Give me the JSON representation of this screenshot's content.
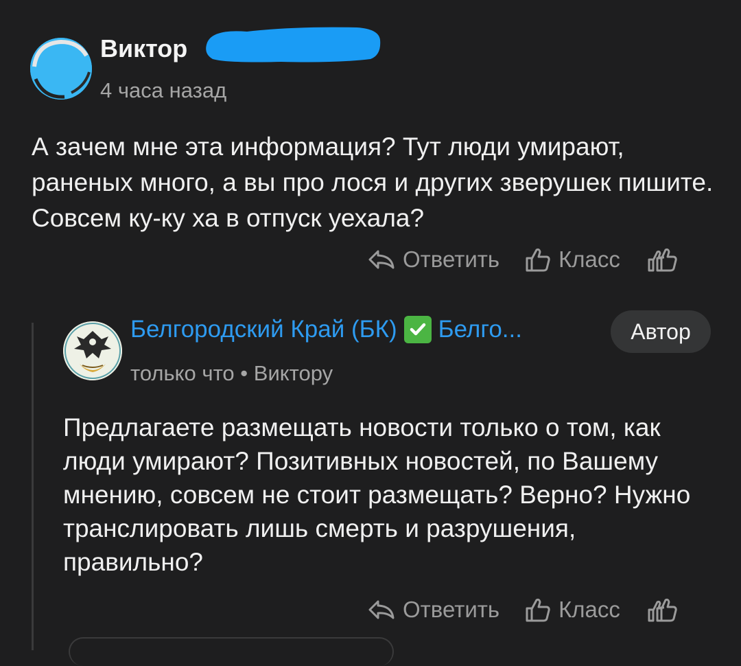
{
  "comment": {
    "author": "Виктор",
    "time": "4 часа назад",
    "text": "А зачем мне эта информация? Тут люди умирают, раненых много, а вы про лося и других зверушек пишите. Совсем ку-ку ха в отпуск уехала?",
    "actions": {
      "reply": "Ответить",
      "like": "Класс"
    }
  },
  "reply": {
    "author": "Белгородский Край (БК)",
    "author_suffix": "Белго...",
    "badge": "Автор",
    "time": "только что",
    "recipient": "Виктору",
    "separator": "•",
    "text": "Предлагаете размещать новости только о том, как люди умирают? Позитивных новостей, по Вашему мнению, совсем не стоит размещать? Верно? Нужно транслировать лишь смерть и разрушения, правильно?",
    "actions": {
      "reply": "Ответить",
      "like": "Класс"
    }
  },
  "colors": {
    "background": "#1e1e1f",
    "link": "#2e9bf0",
    "redaction": "#1a9cf5",
    "muted": "#9b9b9b"
  }
}
